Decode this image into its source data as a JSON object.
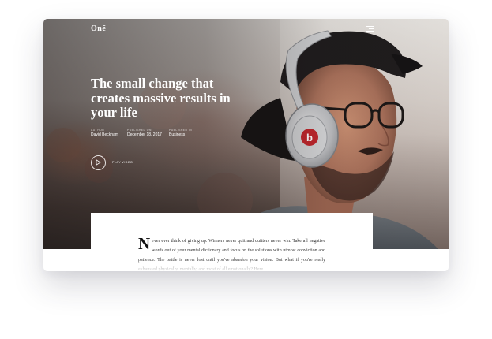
{
  "brand": {
    "logo": "Onē"
  },
  "hero": {
    "title": "The small change that creates massive results in your life",
    "meta": [
      {
        "label": "Author",
        "value": "David Beckham"
      },
      {
        "label": "Published on",
        "value": "December 18, 2017"
      },
      {
        "label": "Published in",
        "value": "Business"
      }
    ],
    "play_label": "Play video"
  },
  "article": {
    "dropcap": "N",
    "body": "ever ever think of giving up. Winners never quit and quitters never win. Take all negative words out of your mental dictionary and focus on the solutions with utmost conviction and patience. The battle is never lost until you've abandon your vision. But what if you're really exhausted physically, mentally, and most of all emotionally? Here"
  },
  "icons": {
    "menu": "hamburger-icon",
    "play": "play-icon"
  },
  "colors": {
    "headphone_logo": "#c0262c",
    "text_dark": "#333333"
  }
}
